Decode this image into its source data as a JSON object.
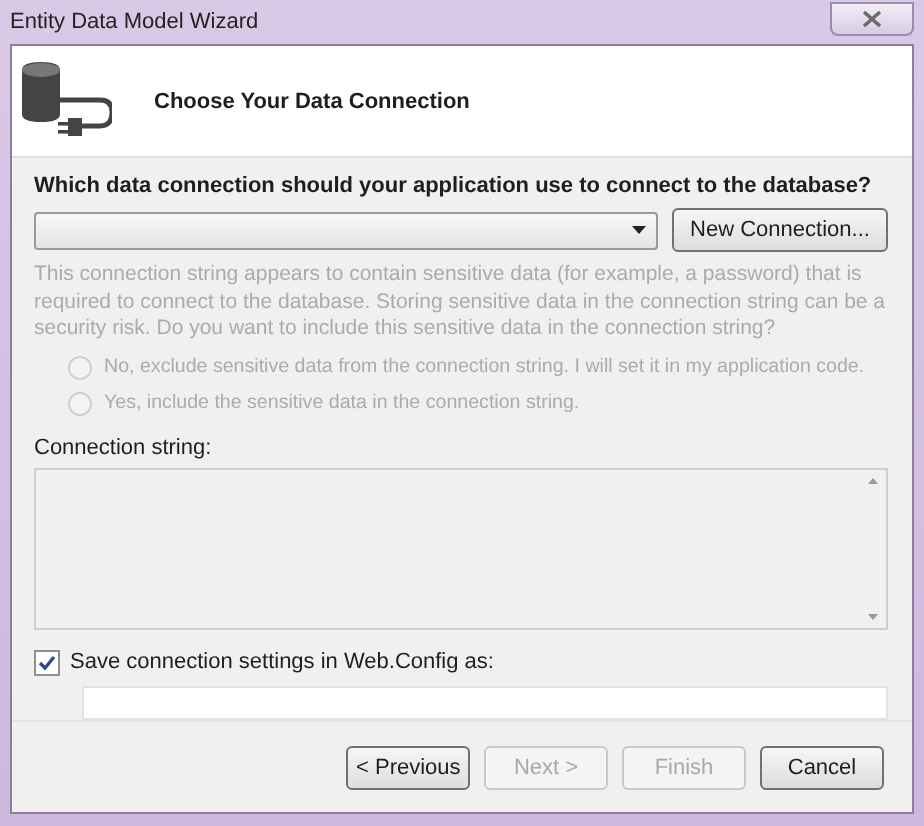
{
  "window": {
    "title": "Entity Data Model Wizard"
  },
  "header": {
    "title": "Choose Your Data Connection"
  },
  "question": "Which data connection should your application use to connect to the database?",
  "new_connection_button": {
    "label": "New Connection...",
    "disabled": false
  },
  "sensitive_data": {
    "message": "This connection string appears to contain sensitive data (for example, a password) that is required to connect to the database. Storing sensitive data in the connection string can be a security risk. Do you want to include this sensitive data in the connection string?",
    "disabled": true,
    "options": [
      {
        "label": "No, exclude sensitive data from the connection string. I will set it in my application code.",
        "selected": false
      },
      {
        "label": "Yes, include the sensitive data in the connection string.",
        "selected": false
      }
    ]
  },
  "connection_string": {
    "label": "Connection string:"
  },
  "save_settings": {
    "label": "Save connection settings in Web.Config as:",
    "checked": true
  },
  "buttons": [
    {
      "label": "< Previous",
      "disabled": false
    },
    {
      "label": "Next >",
      "disabled": true
    },
    {
      "label": "Finish",
      "disabled": true
    },
    {
      "label": "Cancel",
      "disabled": false
    }
  ]
}
